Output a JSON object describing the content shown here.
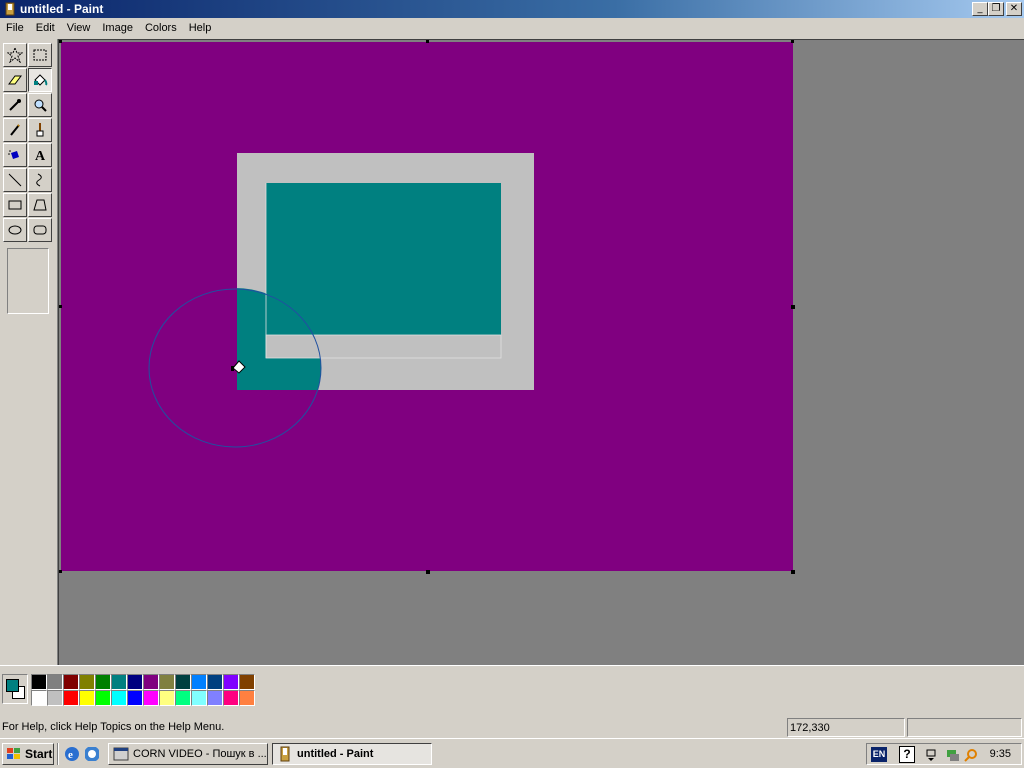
{
  "window": {
    "title": "untitled - Paint",
    "controls": {
      "minimize": "_",
      "restore": "❐",
      "close": "✕"
    }
  },
  "menu": [
    "File",
    "Edit",
    "View",
    "Image",
    "Colors",
    "Help"
  ],
  "tools": [
    {
      "name": "free-form-select-tool",
      "icon": "star-select"
    },
    {
      "name": "select-tool",
      "icon": "rect-select"
    },
    {
      "name": "eraser-tool",
      "icon": "eraser"
    },
    {
      "name": "fill-tool",
      "icon": "paint-bucket",
      "active": true
    },
    {
      "name": "pick-color-tool",
      "icon": "eyedropper"
    },
    {
      "name": "magnifier-tool",
      "icon": "magnifier"
    },
    {
      "name": "pencil-tool",
      "icon": "pencil"
    },
    {
      "name": "brush-tool",
      "icon": "brush"
    },
    {
      "name": "airbrush-tool",
      "icon": "airbrush"
    },
    {
      "name": "text-tool",
      "icon": "text-A"
    },
    {
      "name": "line-tool",
      "icon": "line"
    },
    {
      "name": "curve-tool",
      "icon": "curve"
    },
    {
      "name": "rectangle-tool",
      "icon": "rectangle"
    },
    {
      "name": "polygon-tool",
      "icon": "polygon"
    },
    {
      "name": "ellipse-tool",
      "icon": "ellipse"
    },
    {
      "name": "rounded-rectangle-tool",
      "icon": "rounded-rectangle"
    }
  ],
  "colors": {
    "canvas": "#800080",
    "rect_fill": "#c0c0c0",
    "inner_fill": "#008080",
    "foreground": "#008080",
    "background": "#ffffff",
    "palette_row1": [
      "#000000",
      "#808080",
      "#800000",
      "#808000",
      "#008000",
      "#008080",
      "#000080",
      "#800080",
      "#808040",
      "#004040",
      "#0080ff",
      "#004080",
      "#8000ff",
      "#804000"
    ],
    "palette_row2": [
      "#ffffff",
      "#c0c0c0",
      "#ff0000",
      "#ffff00",
      "#00ff00",
      "#00ffff",
      "#0000ff",
      "#ff00ff",
      "#ffff80",
      "#00ff80",
      "#80ffff",
      "#8080ff",
      "#ff0080",
      "#ff8040"
    ]
  },
  "status": {
    "help": "For Help, click Help Topics on the Help Menu.",
    "coords": "172,330",
    "size": ""
  },
  "taskbar": {
    "start": "Start",
    "quick_launch": [
      "internet-explorer-icon",
      "browser-icon"
    ],
    "tasks": [
      {
        "label": "CORN VIDEO - Пошук в ...",
        "active": false
      },
      {
        "label": "untitled - Paint",
        "active": true
      }
    ],
    "tray": {
      "lang": "EN",
      "help": "?",
      "clock": "9:35"
    }
  }
}
